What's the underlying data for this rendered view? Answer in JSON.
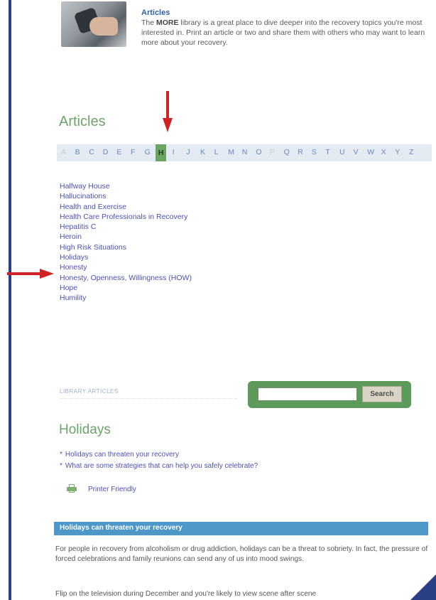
{
  "intro": {
    "title": "Articles",
    "text_bold": "MORE",
    "text_before": "The ",
    "text_after": " library is a great place to dive deeper into the recovery topics you're most interested in. Print an article or two and share them with others who may want to learn more about your recovery."
  },
  "section_title": "Articles",
  "alphabet": [
    "A",
    "B",
    "C",
    "D",
    "E",
    "F",
    "G",
    "H",
    "I",
    "J",
    "K",
    "L",
    "M",
    "N",
    "O",
    "P",
    "Q",
    "R",
    "S",
    "T",
    "U",
    "V",
    "W",
    "X",
    "Y",
    "Z"
  ],
  "alphabet_active": "H",
  "alphabet_dim": [
    "A",
    "P"
  ],
  "articles": [
    "Halfway House",
    "Hallucinations",
    "Health and Exercise",
    "Health Care Professionals in Recovery",
    "Hepatitis C",
    "Heroin",
    "High Risk Situations",
    "Holidays",
    "Honesty",
    "Honesty, Openness, Willingness (HOW)",
    "Hope",
    "Humility"
  ],
  "breadcrumb": "LIBRARY  ARTICLES",
  "search": {
    "button": "Search",
    "placeholder": ""
  },
  "page_title": "Holidays",
  "toc": [
    "Holidays can threaten your recovery",
    "What are some strategies that can help you safely celebrate?"
  ],
  "printer_label": "Printer Friendly",
  "band_title": "Holidays can threaten your recovery",
  "paragraph1": "For people in recovery from alcoholism or drug addiction, holidays can be a threat to sobriety. In fact, the pressure of forced celebrations and family reunions can send any of us into mood swings.",
  "paragraph2": "Flip on the television during December and you're likely to view scene after scene",
  "colors": {
    "accent_green": "#6aa564",
    "link_blue": "#4d51b8",
    "band_blue": "#4d98c9",
    "arrow_red": "#d02323"
  }
}
